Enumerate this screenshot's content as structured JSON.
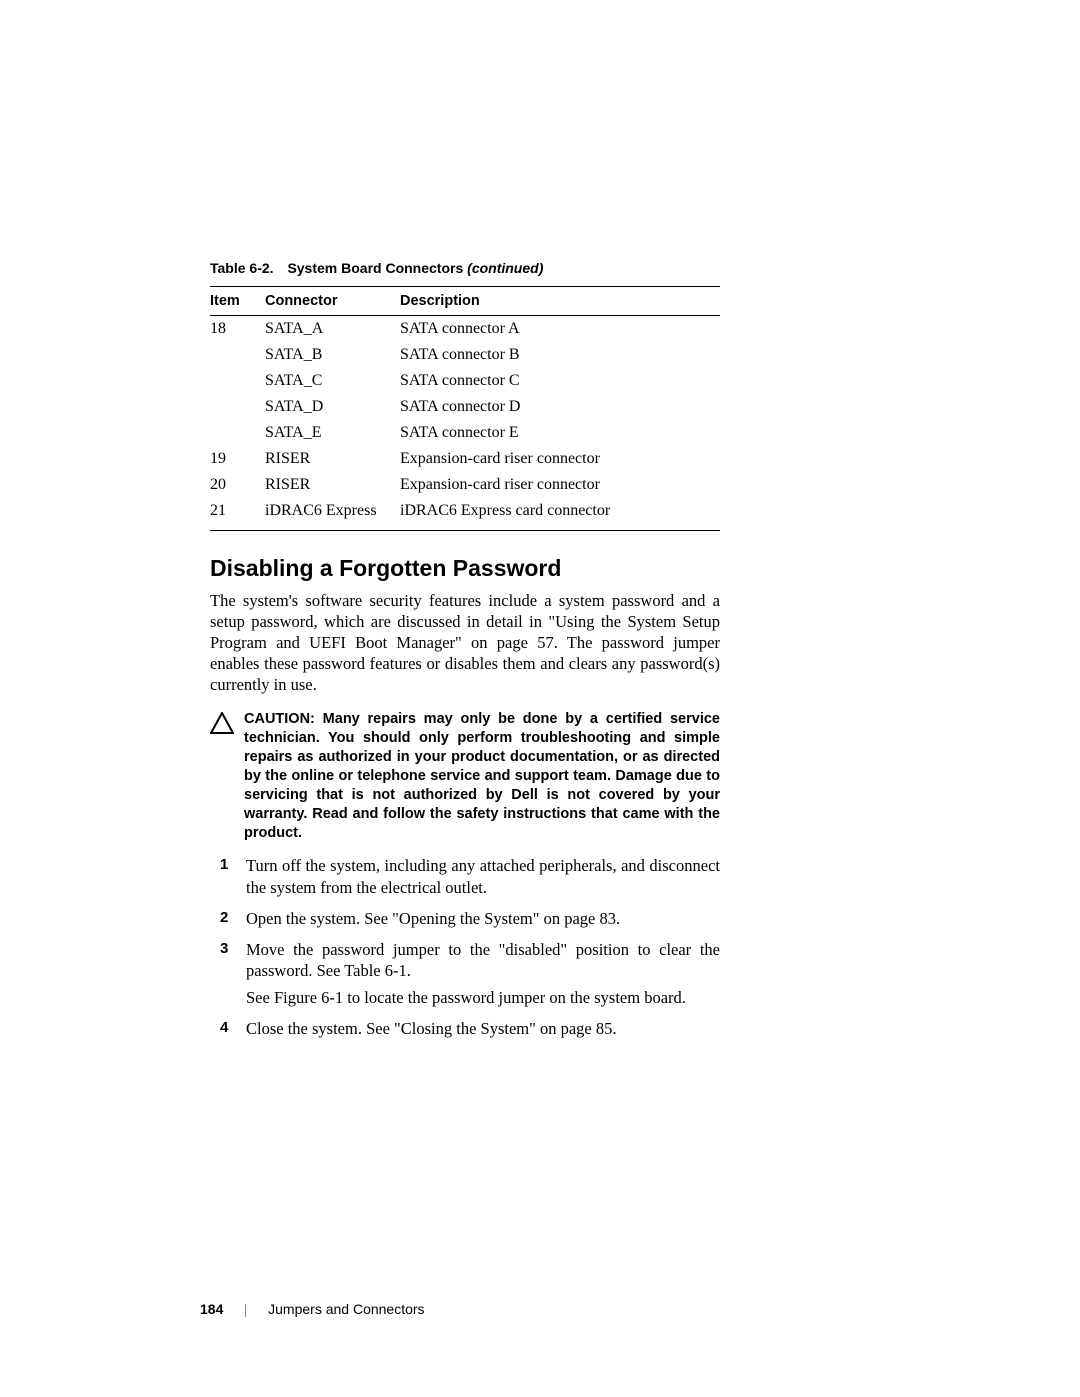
{
  "table": {
    "caption_label": "Table 6-2.",
    "caption_title": "System Board Connectors ",
    "caption_cont": "(continued)",
    "headers": {
      "item": "Item",
      "connector": "Connector",
      "description": "Description"
    },
    "rows": [
      {
        "item": "18",
        "connector": "SATA_A",
        "description": "SATA connector A"
      },
      {
        "item": "",
        "connector": "SATA_B",
        "description": "SATA connector B"
      },
      {
        "item": "",
        "connector": "SATA_C",
        "description": "SATA connector C"
      },
      {
        "item": "",
        "connector": "SATA_D",
        "description": "SATA connector D"
      },
      {
        "item": "",
        "connector": "SATA_E",
        "description": "SATA connector E"
      },
      {
        "item": "19",
        "connector": "RISER",
        "description": "Expansion-card riser connector"
      },
      {
        "item": "20",
        "connector": "RISER",
        "description": "Expansion-card riser connector"
      },
      {
        "item": "21",
        "connector": "iDRAC6 Express",
        "description": "iDRAC6 Express card connector"
      }
    ]
  },
  "section_heading": "Disabling a Forgotten Password",
  "intro_paragraph": "The system's software security features include a system password and a setup password, which are discussed in detail in \"Using the System Setup Program and UEFI Boot Manager\" on page 57. The password jumper enables these password features or disables them and clears any password(s) currently in use.",
  "caution_label": "CAUTION: ",
  "caution_text": "Many repairs may only be done by a certified service technician. You should only perform troubleshooting and simple repairs as authorized in your product documentation, or as directed by the online or telephone service and support team. Damage due to servicing that is not authorized by Dell is not covered by your warranty. Read and follow the safety instructions that came with the product.",
  "steps": [
    {
      "text": "Turn off the system, including any attached peripherals, and disconnect the system from the electrical outlet."
    },
    {
      "text": "Open the system. See \"Opening the System\" on page 83."
    },
    {
      "text": "Move the password jumper to the \"disabled\" position to clear the password. See Table 6-1.",
      "extra": "See Figure 6-1 to locate the password jumper on the system board."
    },
    {
      "text": "Close the system. See \"Closing the System\" on page 85."
    }
  ],
  "footer": {
    "page_number": "184",
    "section": "Jumpers and Connectors"
  }
}
